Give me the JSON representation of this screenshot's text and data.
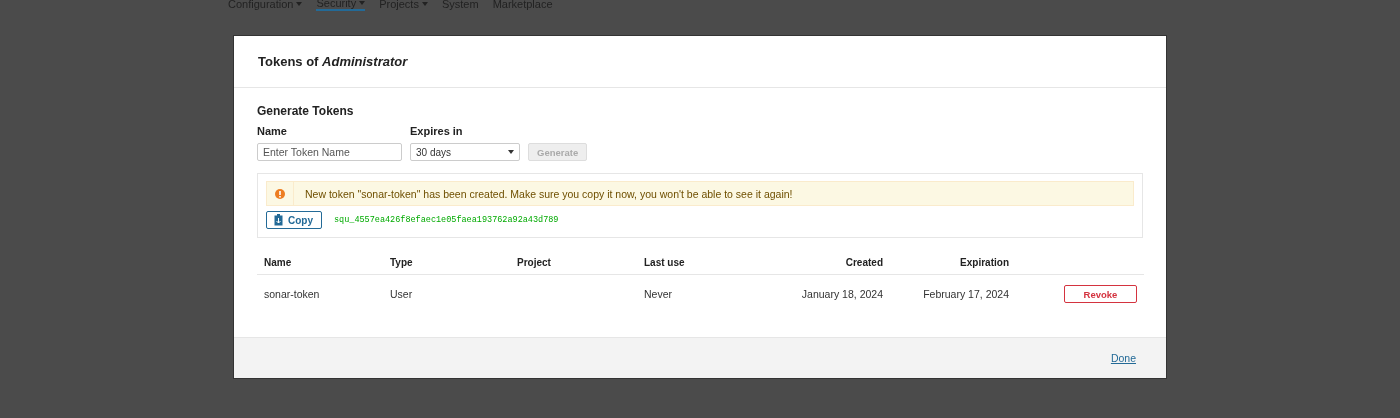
{
  "nav": [
    {
      "label": "Configuration",
      "selected": false,
      "has_menu": true
    },
    {
      "label": "Security",
      "selected": true,
      "has_menu": true
    },
    {
      "label": "Projects",
      "selected": false,
      "has_menu": true
    },
    {
      "label": "System",
      "selected": false,
      "has_menu": false
    },
    {
      "label": "Marketplace",
      "selected": false,
      "has_menu": false
    }
  ],
  "modal": {
    "title": "Tokens of *Administrator*",
    "generate": {
      "heading": "Generate Tokens",
      "name_label": "Name",
      "name_placeholder": "Enter Token Name",
      "expires_label": "Expires in",
      "expires_value": "30 days",
      "generate_button": {
        "label": "Generate",
        "disabled": true
      }
    },
    "alert": {
      "message": "New token \"sonar-token\" has been created. Make sure you copy it now, you won't be able to see it again!"
    },
    "copy_button": "Copy",
    "token": "squ_4557ea426f8efaec1e05faea193762a92a43d789",
    "table": {
      "columns": [
        "Name",
        "Type",
        "Project",
        "Last use",
        "Created",
        "Expiration"
      ],
      "rows": [
        {
          "name": "sonar-token",
          "type": "User",
          "last_use": "Never",
          "created": "January 18, 2024",
          "expiration": "February 17, 2024",
          "action": "Revoke"
        }
      ]
    },
    "footer": {
      "done": "Done"
    }
  }
}
